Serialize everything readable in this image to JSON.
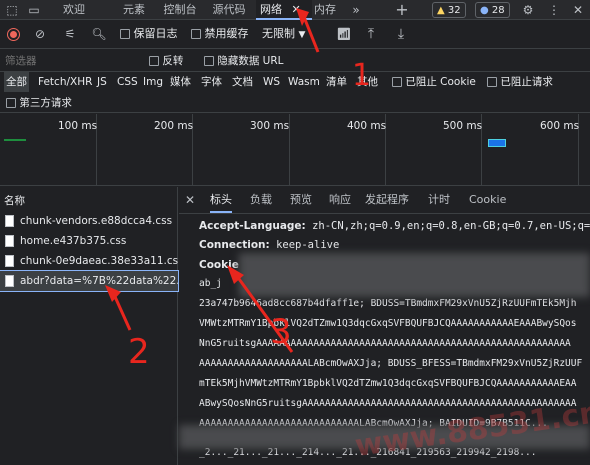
{
  "tabs": {
    "welcome": "欢迎",
    "elements": "元素",
    "console": "控制台",
    "sources": "源代码",
    "network": "网络",
    "memory": "内存",
    "warnings": "32",
    "infos": "28"
  },
  "toolbar": {
    "preserve_log": "保留日志",
    "disable_cache": "禁用缓存",
    "throttle": "无限制"
  },
  "filter": {
    "placeholder": "筛选器",
    "invert": "反转",
    "hide_data_url": "隐藏数据 URL",
    "types": [
      "全部",
      "Fetch/XHR",
      "JS",
      "CSS",
      "Img",
      "媒体",
      "字体",
      "文档",
      "WS",
      "Wasm",
      "清单",
      "其他"
    ],
    "blocked_cookies": "已阻止 Cookie",
    "blocked_requests": "已阻止请求",
    "third_party": "第三方请求"
  },
  "timeline": {
    "ticks": [
      "100 ms",
      "200 ms",
      "300 ms",
      "400 ms",
      "500 ms",
      "600 ms"
    ]
  },
  "requests": {
    "header": "名称",
    "items": [
      "chunk-vendors.e88dcca4.css",
      "home.e437b375.css",
      "chunk-0e9daeac.38e33a11.css",
      "abdr?data=%7B%22data%22..."
    ]
  },
  "detail": {
    "tabs": [
      "标头",
      "负载",
      "预览",
      "响应",
      "发起程序",
      "计时",
      "Cookie"
    ],
    "accept_language_key": "Accept-Language:",
    "accept_language_val": "zh-CN,zh;q=0.9,en;q=0.8,en-GB;q=0.7,en-US;q=0.6",
    "connection_key": "Connection:",
    "connection_val": "keep-alive",
    "cookie_key": "Cookie",
    "cookie_lines": [
      "ab_j",
      "23a747b9646ad8cc687b4dfaff1e; BDUSS=TBmdmxFM29xVnU5ZjRzUUFmTEk5Mjh",
      "VMWtzMTRmY1BpbklVQ2dTZmw1Q3dqcGxqSVFBQUFBJCQAAAAAAAAAAAEAAABwySQos",
      "NnG5ruitsgAAAAAAAAAAAAAAAAAAAAAAAAAAAAAAAAAAAAAAAAAAAAAAAAAAAAAAA",
      "AAAAAAAAAAAAAAAAAAALABcmOwAXJja; BDUSS_BFESS=TBmdmxFM29xVnU5ZjRzUUF",
      "mTEk5MjhVMWtzMTRmY1BpbklVQ2dTZmw1Q3dqcGxqSVFBQUFBJCQAAAAAAAAAAAEAA",
      "ABwySQosNnG5ruitsgAAAAAAAAAAAAAAAAAAAAAAAAAAAAAAAAAAAAAAAAAAAAAAAA",
      "AAAAAAAAAAAAAAAAAAAAAAAAAAAALABcmOwAXJja; BAIDUID=9B7B511C...",
      "_2..._21..._21..._214..._21..._216841_219563_219942_2198..."
    ],
    "watermark": "www.88531.cn"
  },
  "annotations": [
    "1",
    "2",
    "3"
  ],
  "colors": {
    "accent": "#8ab4f8",
    "annotation": "#e8261e",
    "record": "#ee675c"
  }
}
